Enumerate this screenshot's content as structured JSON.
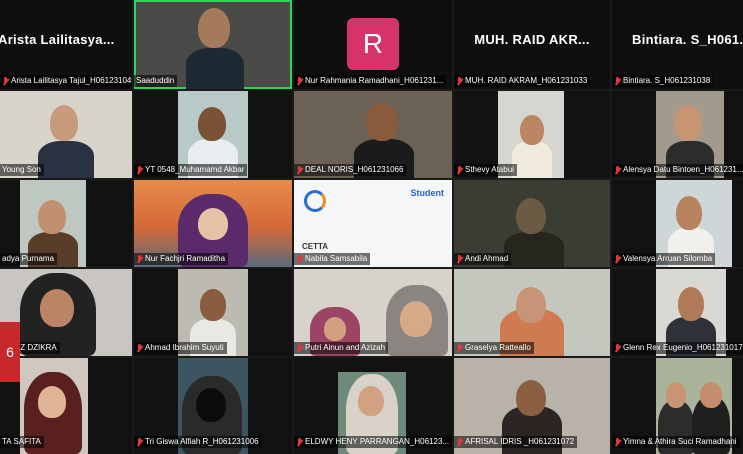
{
  "meeting": {
    "page_indicator": "6",
    "participants": [
      {
        "id": "p1",
        "name": "Arista Lailitasya Tajul_H061231049",
        "big_name": "Arista  Lailitasya...",
        "video": false,
        "muted": true
      },
      {
        "id": "p2",
        "name": "Saaduddin",
        "video": true,
        "muted": false,
        "active_speaker": true
      },
      {
        "id": "p3",
        "name": "Nur Rahmania Ramadhani_H061231...",
        "video": false,
        "avatar_letter": "R",
        "muted": true
      },
      {
        "id": "p4",
        "name": "MUH. RAID AKRAM_H061231033",
        "big_name": "MUH.  RAID  AKR...",
        "video": false,
        "muted": true
      },
      {
        "id": "p5",
        "name": "Bintiara. S_H061231038",
        "big_name": "Bintiara.  S_H061...",
        "video": false,
        "muted": true
      },
      {
        "id": "p6",
        "name": "Young Son",
        "video": true
      },
      {
        "id": "p7",
        "name": "YT 0548_Muhamamd Akbar",
        "video": true,
        "muted": true
      },
      {
        "id": "p8",
        "name": "DEAL NORIS_H061231066",
        "video": true,
        "muted": true
      },
      {
        "id": "p9",
        "name": "Sthevy Atabui",
        "video": true,
        "muted": true
      },
      {
        "id": "p10",
        "name": "Alensya Datu Bintoen_H061231...",
        "video": true,
        "muted": true
      },
      {
        "id": "p11",
        "name": "adya Purnama",
        "video": true
      },
      {
        "id": "p12",
        "name": "Nur Fachjri Ramaditha",
        "video": true,
        "muted": true
      },
      {
        "id": "p13",
        "name": "Nabila Samsabila",
        "video": true,
        "muted": true,
        "slide": {
          "header": "Student",
          "brand": "CETTA"
        }
      },
      {
        "id": "p14",
        "name": "Andi Ahmad",
        "video": true,
        "muted": true
      },
      {
        "id": "p15",
        "name": "Valensya Arruan Silomba",
        "video": true,
        "muted": true
      },
      {
        "id": "p16",
        "name": "QA AZ DZIKRA",
        "video": true
      },
      {
        "id": "p17",
        "name": "Ahmad Ibrahim Suyuti",
        "video": true,
        "muted": true
      },
      {
        "id": "p18",
        "name": "Putri Ainun and Azizah",
        "video": true,
        "muted": true
      },
      {
        "id": "p19",
        "name": "Graselya Ratteallo",
        "video": true,
        "muted": true
      },
      {
        "id": "p20",
        "name": "Glenn Rex Eugenio_H061231017",
        "video": true,
        "muted": true
      },
      {
        "id": "p21",
        "name": "TA SAFITA",
        "video": true
      },
      {
        "id": "p22",
        "name": "Tri Giswa Alfiah R_H061231006",
        "video": true,
        "muted": true
      },
      {
        "id": "p23",
        "name": "ELDWY HENY PARRANGAN_H06123...",
        "video": true,
        "muted": true
      },
      {
        "id": "p24",
        "name": "AFRISAL IDRIS _H061231072",
        "video": true,
        "muted": true
      },
      {
        "id": "p25",
        "name": "Yimna & Athira Suci Ramadhani",
        "video": true,
        "muted": true
      }
    ]
  },
  "colors": {
    "speaker_border": "#2fd35b",
    "muted_icon": "#e0383e",
    "avatar_bg": "#d6336c",
    "badge_bg": "#c6282b"
  }
}
